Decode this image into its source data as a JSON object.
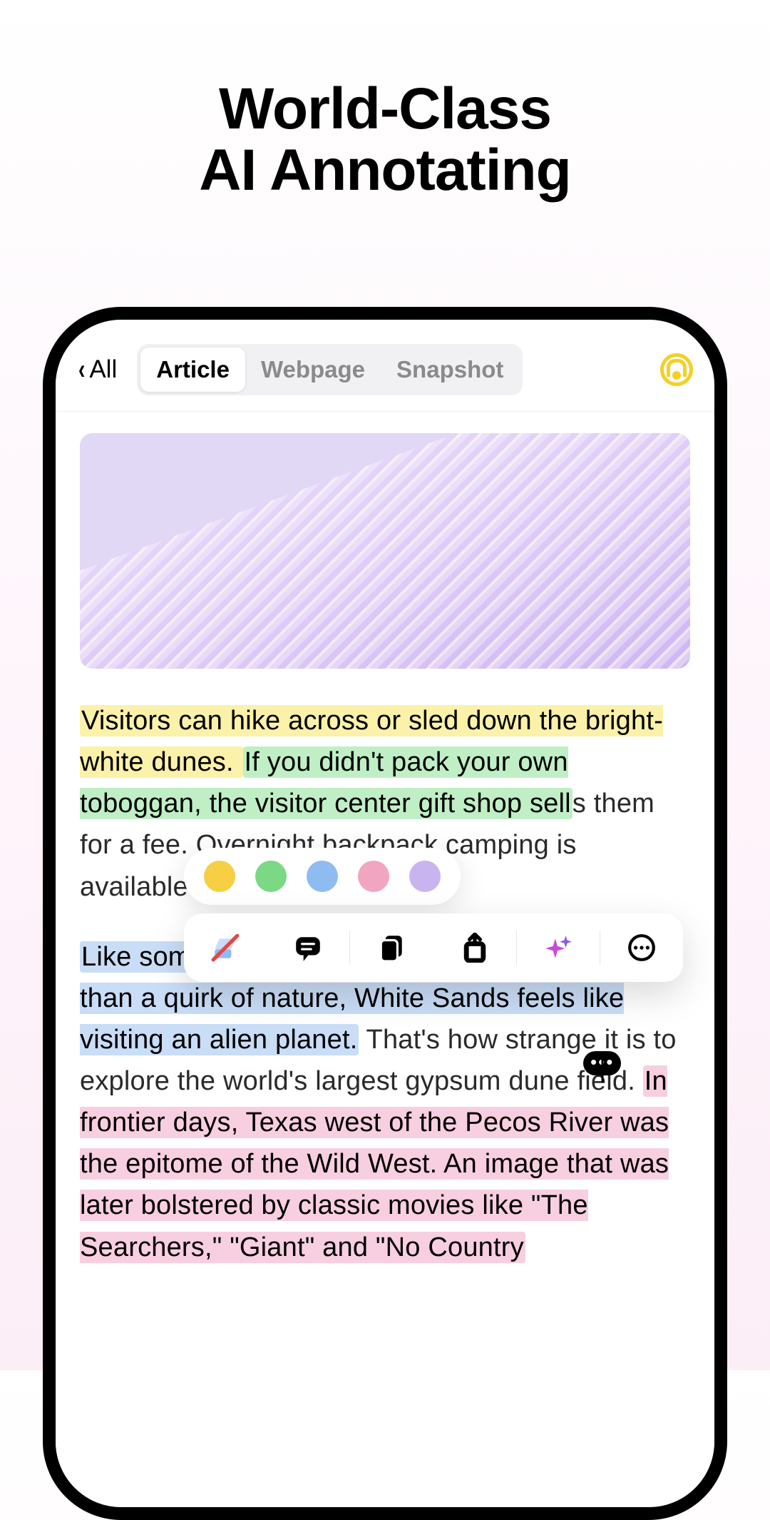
{
  "headline_line1": "World-Class",
  "headline_line2": "AI Annotating",
  "nav": {
    "back_label": "All",
    "tabs": [
      "Article",
      "Webpage",
      "Snapshot"
    ],
    "active_tab_index": 0
  },
  "highlight_colors": [
    "yellow",
    "green",
    "blue",
    "pink",
    "purple"
  ],
  "action_icons": [
    "remove-highlight",
    "comment",
    "copy",
    "share",
    "ai-sparkle",
    "more"
  ],
  "article": {
    "segments": [
      {
        "text": "Visitors can hike across or sled down the bright-white dunes. ",
        "highlight": "yellow"
      },
      {
        "text": "If you didn't pack your own toboggan, the visitor center gift shop sell",
        "highlight": "green"
      },
      {
        "text": "s them for a fee. Overnight backpack camping is available along a sandy trail.",
        "highlight": null
      },
      {
        "paragraph_break": true
      },
      {
        "text": "Like something created for a sci-fi movie rather than a quirk of nature, White Sands feels like visiting an alien planet.",
        "highlight": "blue"
      },
      {
        "text": " That's how strange it is to explore the world's largest gypsum dune field. ",
        "highlight": null
      },
      {
        "text": "In frontier days, Texas west of the Pecos River was the epitome of the Wild West. An image that was later bolstered by classic movies like \"The Searchers,\" \"Giant\" and \"No Country",
        "highlight": "pink"
      }
    ]
  },
  "selection_handle_glyph": "•••"
}
